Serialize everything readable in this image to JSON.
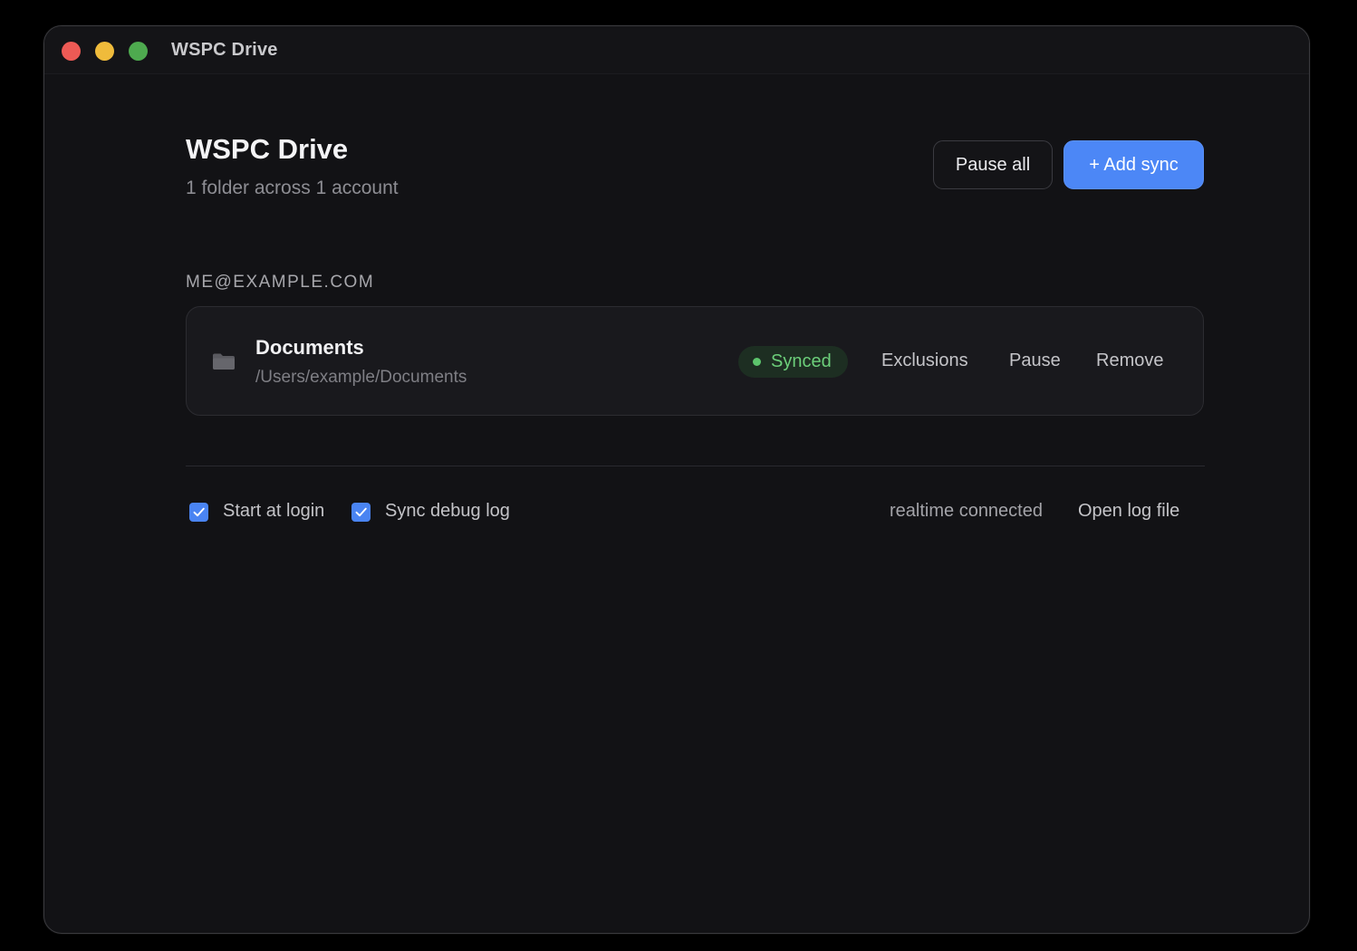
{
  "window": {
    "title": "WSPC Drive",
    "controls": [
      "close",
      "minimize",
      "maximize"
    ]
  },
  "header": {
    "title": "WSPC Drive",
    "subtitle": "1 folder across 1 account",
    "pause_all_label": "Pause all",
    "add_sync_label": "+ Add sync"
  },
  "accounts": [
    {
      "email": "ME@EXAMPLE.COM",
      "folders": [
        {
          "name": "Documents",
          "path": "/Users/example/Documents",
          "icon": "folder-icon",
          "status": "Synced",
          "actions": {
            "exclusions": "Exclusions",
            "pause": "Pause",
            "remove": "Remove"
          }
        }
      ]
    }
  ],
  "footer": {
    "start_at_login": {
      "label": "Start at login",
      "checked": true
    },
    "sync_debug_log": {
      "label": "Sync debug log",
      "checked": true
    },
    "connection_status": "realtime connected",
    "open_log_label": "Open log file"
  },
  "colors": {
    "accent": "#4c87f6",
    "status_synced": "#6ccf7a",
    "background": "#121215",
    "traffic_close": "#ed5a55",
    "traffic_minimize": "#efbb3b",
    "traffic_maximize": "#4eaa4f"
  }
}
